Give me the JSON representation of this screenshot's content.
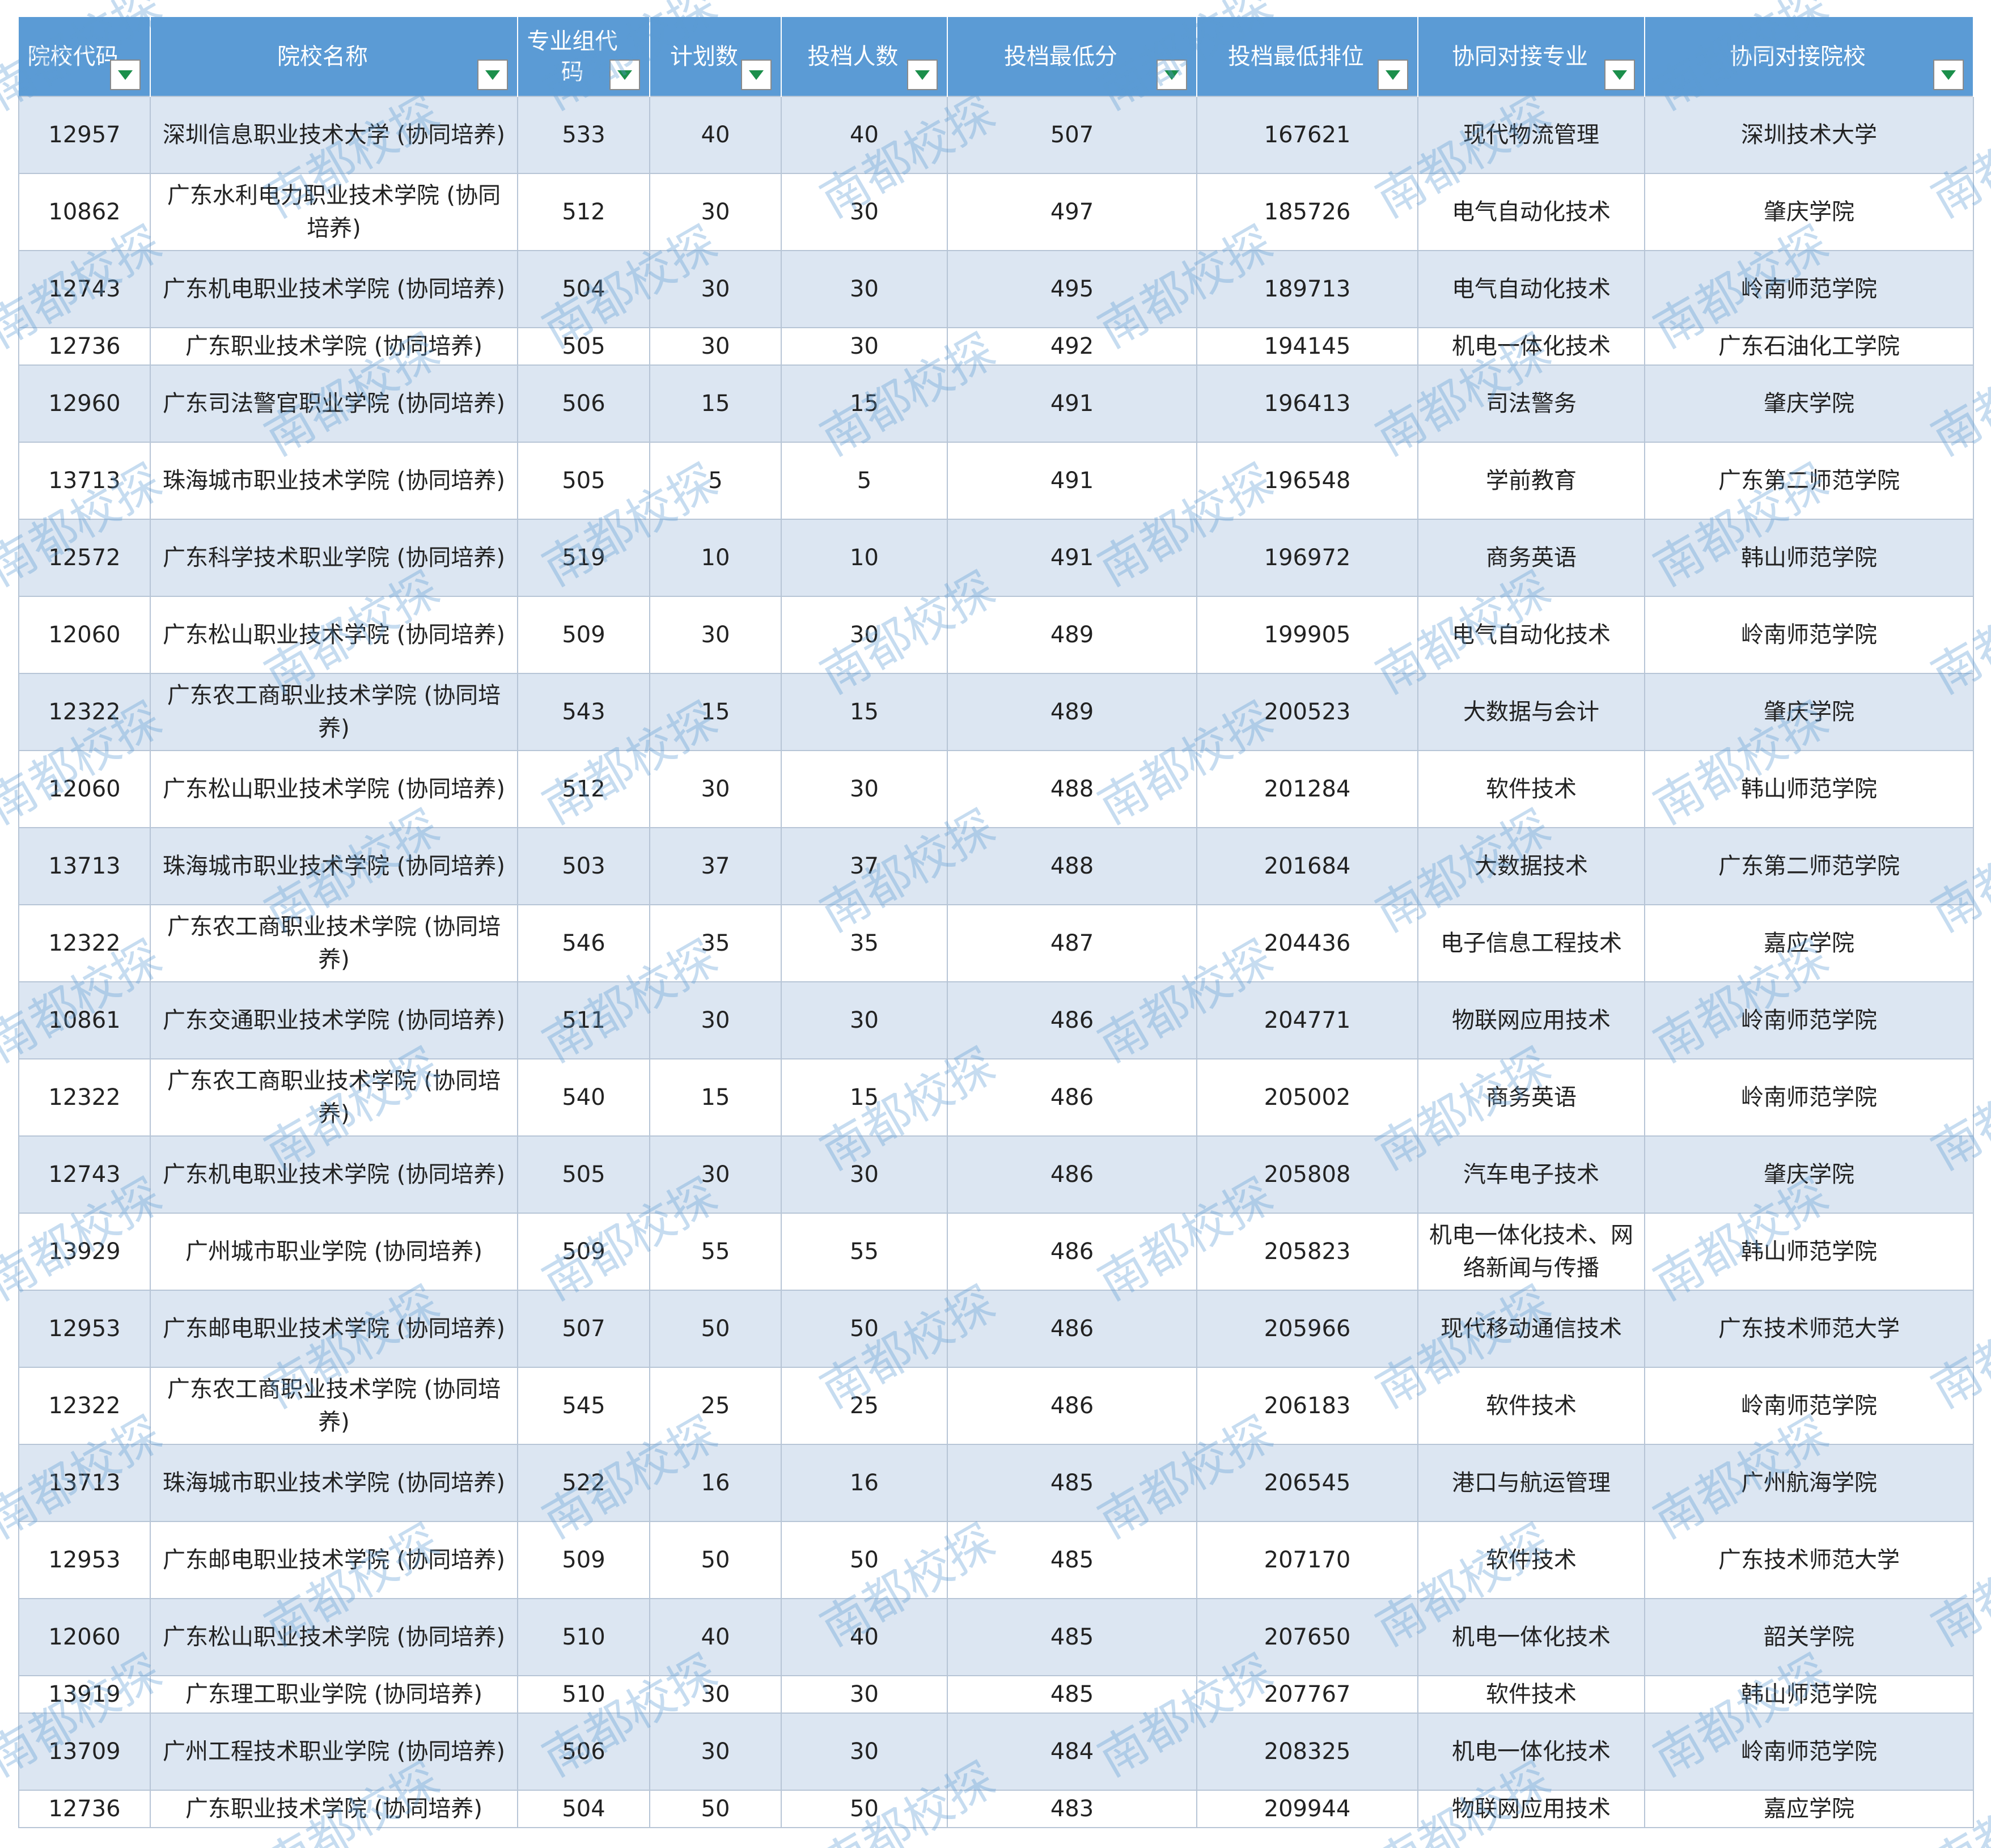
{
  "headers": [
    {
      "label": "院校代码"
    },
    {
      "label": "院校名称"
    },
    {
      "label": "专业组代码"
    },
    {
      "label": "计划数"
    },
    {
      "label": "投档人数"
    },
    {
      "label": "投档最低分"
    },
    {
      "label": "投档最低排位"
    },
    {
      "label": "协同对接专业"
    },
    {
      "label": "协同对接院校"
    }
  ],
  "rows": [
    [
      "12957",
      "深圳信息职业技术大学 (协同培养)",
      "533",
      "40",
      "40",
      "507",
      "167621",
      "现代物流管理",
      "深圳技术大学"
    ],
    [
      "10862",
      "广东水利电力职业技术学院 (协同培养)",
      "512",
      "30",
      "30",
      "497",
      "185726",
      "电气自动化技术",
      "肇庆学院"
    ],
    [
      "12743",
      "广东机电职业技术学院 (协同培养)",
      "504",
      "30",
      "30",
      "495",
      "189713",
      "电气自动化技术",
      "岭南师范学院"
    ],
    [
      "12736",
      "广东职业技术学院 (协同培养)",
      "505",
      "30",
      "30",
      "492",
      "194145",
      "机电一体化技术",
      "广东石油化工学院"
    ],
    [
      "12960",
      "广东司法警官职业学院 (协同培养)",
      "506",
      "15",
      "15",
      "491",
      "196413",
      "司法警务",
      "肇庆学院"
    ],
    [
      "13713",
      "珠海城市职业技术学院 (协同培养)",
      "505",
      "5",
      "5",
      "491",
      "196548",
      "学前教育",
      "广东第二师范学院"
    ],
    [
      "12572",
      "广东科学技术职业学院 (协同培养)",
      "519",
      "10",
      "10",
      "491",
      "196972",
      "商务英语",
      "韩山师范学院"
    ],
    [
      "12060",
      "广东松山职业技术学院 (协同培养)",
      "509",
      "30",
      "30",
      "489",
      "199905",
      "电气自动化技术",
      "岭南师范学院"
    ],
    [
      "12322",
      "广东农工商职业技术学院 (协同培养)",
      "543",
      "15",
      "15",
      "489",
      "200523",
      "大数据与会计",
      "肇庆学院"
    ],
    [
      "12060",
      "广东松山职业技术学院 (协同培养)",
      "512",
      "30",
      "30",
      "488",
      "201284",
      "软件技术",
      "韩山师范学院"
    ],
    [
      "13713",
      "珠海城市职业技术学院 (协同培养)",
      "503",
      "37",
      "37",
      "488",
      "201684",
      "大数据技术",
      "广东第二师范学院"
    ],
    [
      "12322",
      "广东农工商职业技术学院 (协同培养)",
      "546",
      "35",
      "35",
      "487",
      "204436",
      "电子信息工程技术",
      "嘉应学院"
    ],
    [
      "10861",
      "广东交通职业技术学院 (协同培养)",
      "511",
      "30",
      "30",
      "486",
      "204771",
      "物联网应用技术",
      "岭南师范学院"
    ],
    [
      "12322",
      "广东农工商职业技术学院 (协同培养)",
      "540",
      "15",
      "15",
      "486",
      "205002",
      "商务英语",
      "岭南师范学院"
    ],
    [
      "12743",
      "广东机电职业技术学院 (协同培养)",
      "505",
      "30",
      "30",
      "486",
      "205808",
      "汽车电子技术",
      "肇庆学院"
    ],
    [
      "13929",
      "广州城市职业学院 (协同培养)",
      "509",
      "55",
      "55",
      "486",
      "205823",
      "机电一体化技术、网络新闻与传播",
      "韩山师范学院"
    ],
    [
      "12953",
      "广东邮电职业技术学院 (协同培养)",
      "507",
      "50",
      "50",
      "486",
      "205966",
      "现代移动通信技术",
      "广东技术师范大学"
    ],
    [
      "12322",
      "广东农工商职业技术学院 (协同培养)",
      "545",
      "25",
      "25",
      "486",
      "206183",
      "软件技术",
      "岭南师范学院"
    ],
    [
      "13713",
      "珠海城市职业技术学院 (协同培养)",
      "522",
      "16",
      "16",
      "485",
      "206545",
      "港口与航运管理",
      "广州航海学院"
    ],
    [
      "12953",
      "广东邮电职业技术学院 (协同培养)",
      "509",
      "50",
      "50",
      "485",
      "207170",
      "软件技术",
      "广东技术师范大学"
    ],
    [
      "12060",
      "广东松山职业技术学院 (协同培养)",
      "510",
      "40",
      "40",
      "485",
      "207650",
      "机电一体化技术",
      "韶关学院"
    ],
    [
      "13919",
      "广东理工职业学院 (协同培养)",
      "510",
      "30",
      "30",
      "485",
      "207767",
      "软件技术",
      "韩山师范学院"
    ],
    [
      "13709",
      "广州工程技术职业学院 (协同培养)",
      "506",
      "30",
      "30",
      "484",
      "208325",
      "机电一体化技术",
      "岭南师范学院"
    ],
    [
      "12736",
      "广东职业技术学院 (协同培养)",
      "504",
      "50",
      "50",
      "483",
      "209944",
      "物联网应用技术",
      "嘉应学院"
    ]
  ],
  "watermark": "南都校探"
}
